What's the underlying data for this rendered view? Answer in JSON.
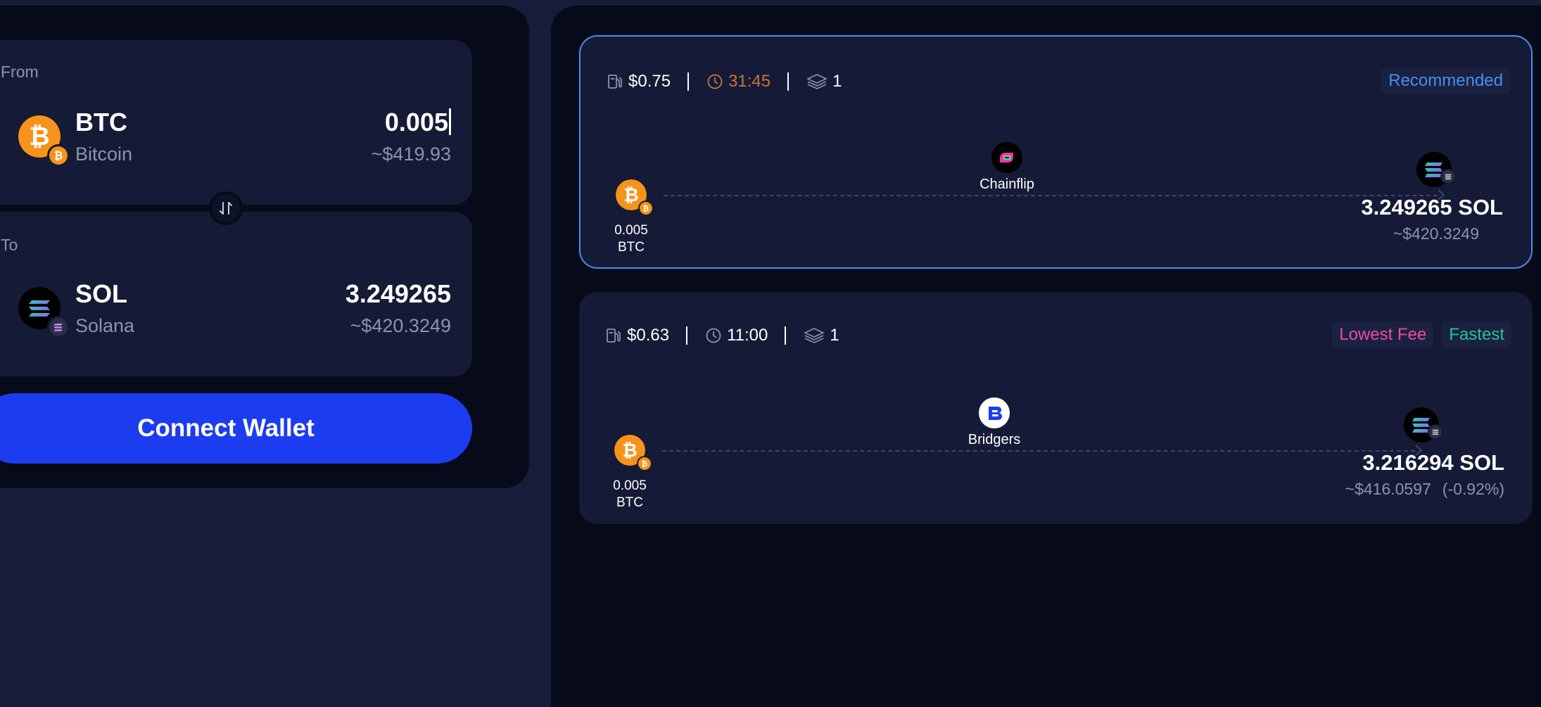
{
  "swap": {
    "from": {
      "label": "From",
      "symbol": "BTC",
      "name": "Bitcoin",
      "amount": "0.005",
      "usd": "~$419.93",
      "icon": "bitcoin-icon",
      "color": "#f7931a"
    },
    "to": {
      "label": "To",
      "symbol": "SOL",
      "name": "Solana",
      "amount": "3.249265",
      "usd": "~$420.3249",
      "icon": "solana-icon",
      "color": "#000000"
    },
    "swap_icon": "swap-arrows-icon",
    "connect_label": "Connect Wallet"
  },
  "routes": [
    {
      "fee": "$0.75",
      "time": "31:45",
      "steps": "1",
      "tags": [
        "Recommended"
      ],
      "provider": "Chainflip",
      "src_amount": "0.005",
      "src_symbol": "BTC",
      "out_amount": "3.249265 SOL",
      "out_usd": "~$420.3249",
      "out_pct": "",
      "selected": true
    },
    {
      "fee": "$0.63",
      "time": "11:00",
      "steps": "1",
      "tags": [
        "Lowest Fee",
        "Fastest"
      ],
      "provider": "Bridgers",
      "src_amount": "0.005",
      "src_symbol": "BTC",
      "out_amount": "3.216294 SOL",
      "out_usd": "~$416.0597",
      "out_pct": "(-0.92%)",
      "selected": false
    }
  ],
  "colors": {
    "accent_blue": "#1c3cf0",
    "selected_border": "#4a8ef0",
    "tag_pink": "#ea4d9a",
    "tag_green": "#27c593",
    "time_orange": "#c8743e"
  }
}
